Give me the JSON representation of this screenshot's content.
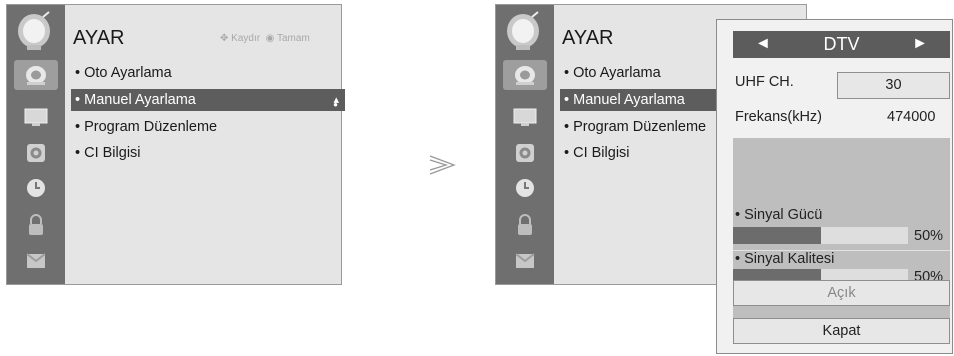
{
  "left_panel": {
    "title": "AYAR",
    "hint_move": "Kaydır",
    "hint_ok": "Tamam",
    "menu_items": [
      "Oto Ayarlama",
      "Manuel Ayarlama",
      "Program Düzenleme",
      "CI Bilgisi"
    ],
    "selected_index": 1
  },
  "right_panel": {
    "title": "AYAR",
    "menu_items": [
      "Oto Ayarlama",
      "Manuel Ayarlama",
      "Program Düzenleme",
      "CI Bilgisi"
    ],
    "selected_index": 1
  },
  "separator_symbol": ">",
  "dialog": {
    "mode": "DTV",
    "uhf_label": "UHF CH.",
    "uhf_value": "30",
    "freq_label": "Frekans(kHz)",
    "freq_value": "474000",
    "signal_strength_label": "Sinyal Gücü",
    "signal_strength_value": "50%",
    "signal_strength_level": 0.5,
    "signal_quality_label": "Sinyal Kalitesi",
    "signal_quality_value": "50%",
    "signal_quality_level": 0.5,
    "open_button": "Açık",
    "close_button": "Kapat"
  },
  "sidebar_icons": [
    "satellite-dish-icon",
    "picture-icon",
    "audio-icon",
    "clock-icon",
    "lock-icon",
    "option-icon"
  ],
  "colors": {
    "sidebar": "#6f6f6f",
    "selection": "#5d5d5d",
    "panel": "#e5e5e5"
  }
}
